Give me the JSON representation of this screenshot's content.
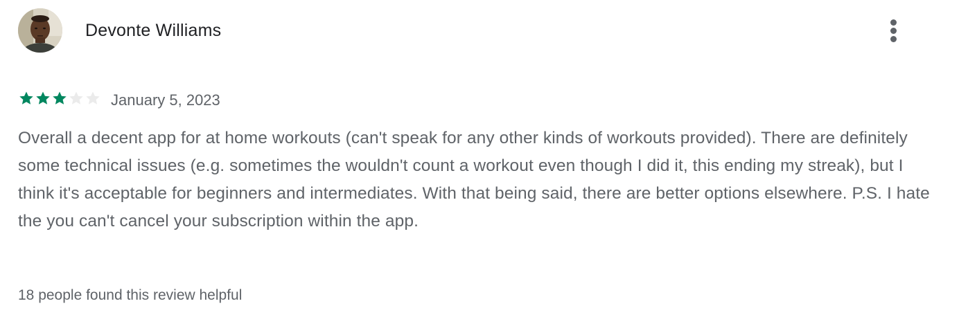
{
  "review": {
    "author": "Devonte Williams",
    "avatar_icon": "user-photo-avatar",
    "more_icon": "vertical-dots-icon",
    "rating": 3,
    "rating_max": 5,
    "star_color_filled": "#01875f",
    "star_color_empty": "#ebebeb",
    "date": "January 5, 2023",
    "text": "Overall a decent app for at home workouts (can't speak for any other kinds of workouts provided). There are definitely some technical issues (e.g. sometimes the wouldn't count a workout even though I did it, this ending my streak), but I think it's acceptable for beginners and intermediates. With that being said, there are better options elsewhere. P.S. I hate the you can't cancel your subscription within the app.",
    "helpful": "18 people found this review helpful"
  }
}
